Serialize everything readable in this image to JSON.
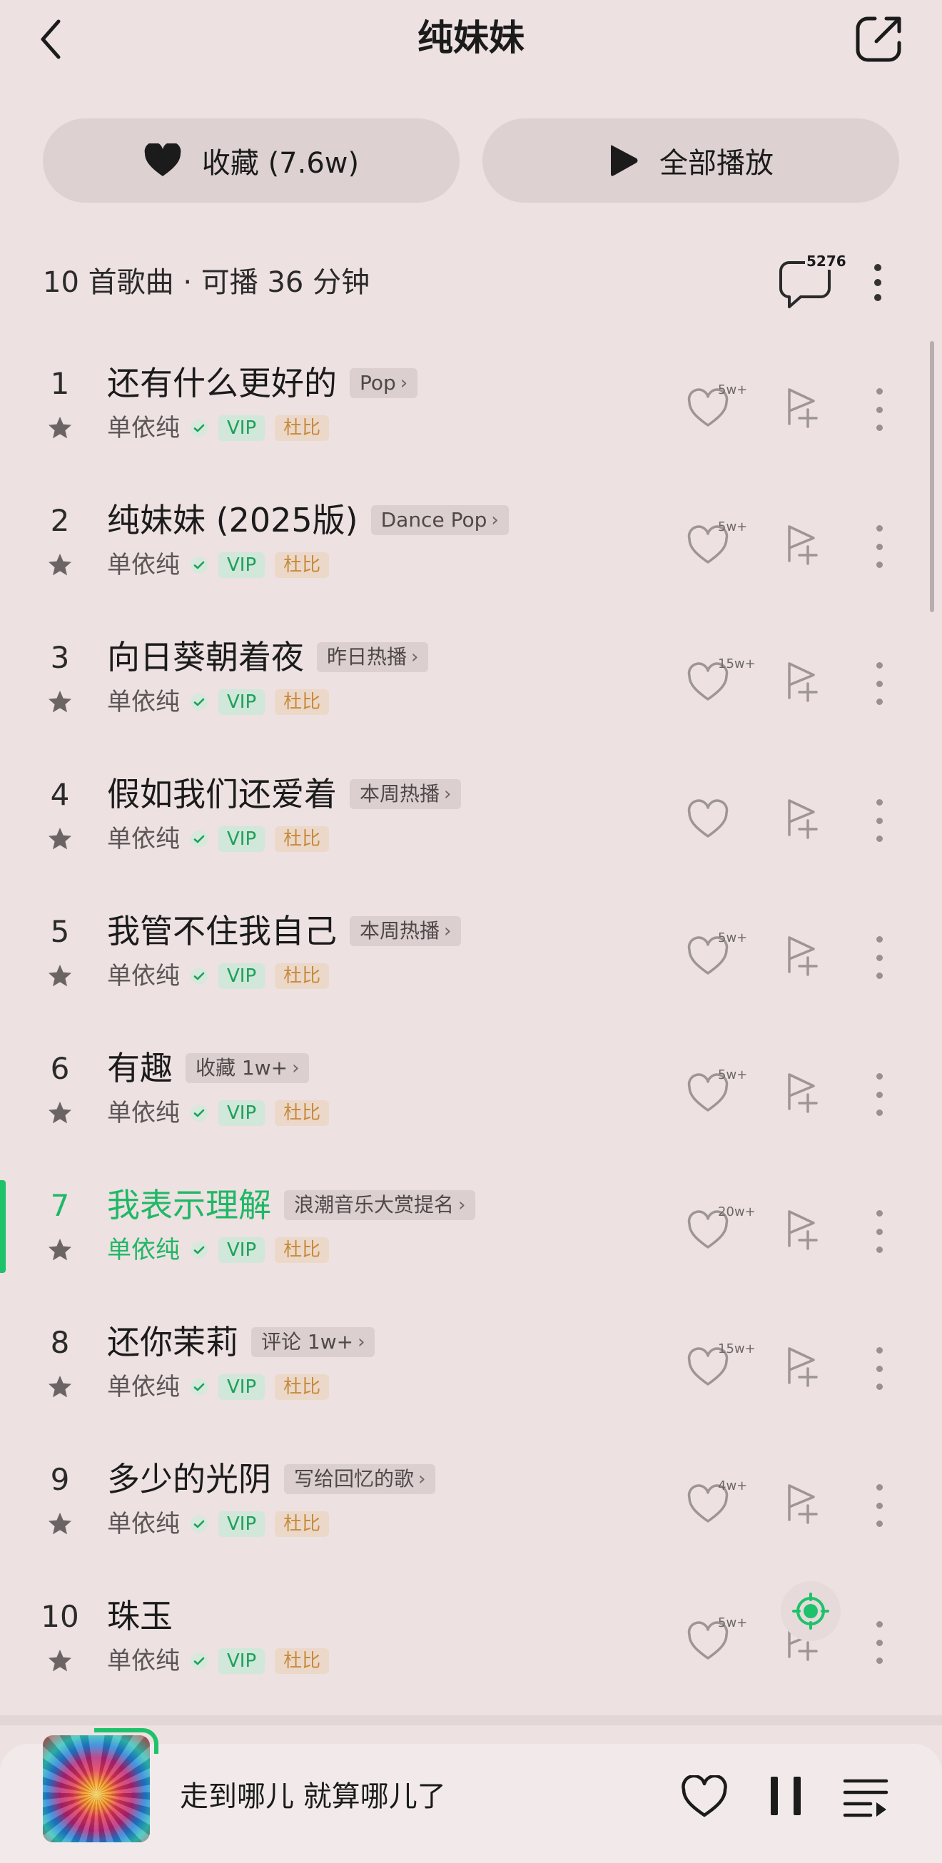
{
  "header": {
    "title": "纯妹妹"
  },
  "actions": {
    "favorite_label": "收藏 (7.6w)",
    "play_all_label": "全部播放"
  },
  "summary": {
    "text": "10 首歌曲 · 可播 36 分钟",
    "comment_count": "5276"
  },
  "songs": [
    {
      "index": "1",
      "title": "还有什么更好的",
      "tag": "Pop",
      "artist": "单依纯",
      "vip": "VIP",
      "dolby": "杜比",
      "likes": "5w+",
      "current": false
    },
    {
      "index": "2",
      "title": "纯妹妹 (2025版)",
      "tag": "Dance Pop",
      "artist": "单依纯",
      "vip": "VIP",
      "dolby": "杜比",
      "likes": "5w+",
      "current": false
    },
    {
      "index": "3",
      "title": "向日葵朝着夜",
      "tag": "昨日热播",
      "artist": "单依纯",
      "vip": "VIP",
      "dolby": "杜比",
      "likes": "15w+",
      "current": false
    },
    {
      "index": "4",
      "title": "假如我们还爱着",
      "tag": "本周热播",
      "artist": "单依纯",
      "vip": "VIP",
      "dolby": "杜比",
      "likes": "",
      "current": false
    },
    {
      "index": "5",
      "title": "我管不住我自己",
      "tag": "本周热播",
      "artist": "单依纯",
      "vip": "VIP",
      "dolby": "杜比",
      "likes": "5w+",
      "current": false
    },
    {
      "index": "6",
      "title": "有趣",
      "tag": "收藏 1w+",
      "artist": "单依纯",
      "vip": "VIP",
      "dolby": "杜比",
      "likes": "5w+",
      "current": false
    },
    {
      "index": "7",
      "title": "我表示理解",
      "tag": "浪潮音乐大赏提名",
      "artist": "单依纯",
      "vip": "VIP",
      "dolby": "杜比",
      "likes": "20w+",
      "current": true
    },
    {
      "index": "8",
      "title": "还你茉莉",
      "tag": "评论 1w+",
      "artist": "单依纯",
      "vip": "VIP",
      "dolby": "杜比",
      "likes": "15w+",
      "current": false
    },
    {
      "index": "9",
      "title": "多少的光阴",
      "tag": "写给回忆的歌",
      "artist": "单依纯",
      "vip": "VIP",
      "dolby": "杜比",
      "likes": "4w+",
      "current": false
    },
    {
      "index": "10",
      "title": "珠玉",
      "tag": "",
      "artist": "单依纯",
      "vip": "VIP",
      "dolby": "杜比",
      "likes": "5w+",
      "current": false
    }
  ],
  "player": {
    "now_playing": "走到哪儿 就算哪儿了"
  },
  "colors": {
    "background": "#ede1e2",
    "accent": "#1ec26a",
    "vip_text": "#1da05a",
    "dolby_text": "#c68a3d"
  },
  "icons": [
    "back-arrow-icon",
    "share-icon",
    "heart-icon",
    "play-icon",
    "comment-icon",
    "more-vertical-icon",
    "star-icon",
    "verified-check-icon",
    "add-to-playlist-icon",
    "locate-icon",
    "pause-icon",
    "playlist-icon"
  ]
}
